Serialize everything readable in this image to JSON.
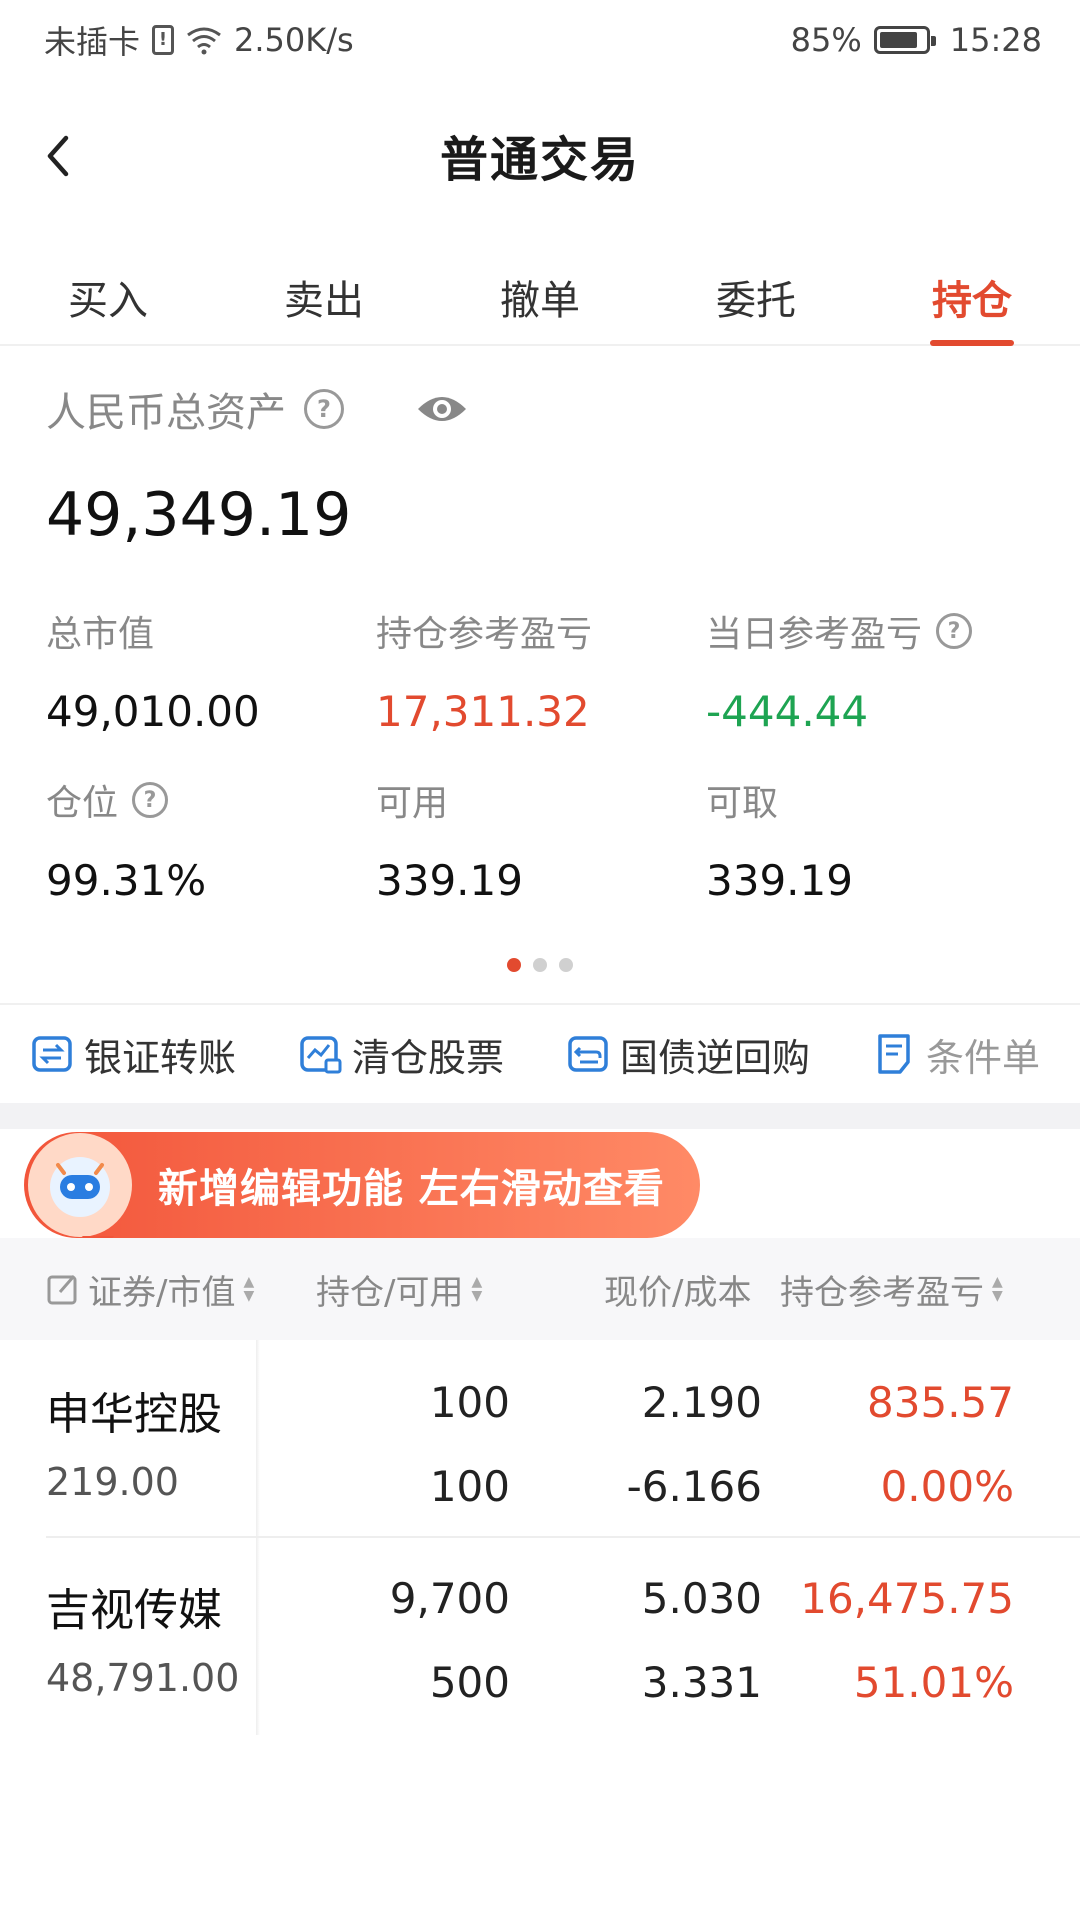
{
  "status_bar": {
    "carrier": "未插卡",
    "speed": "2.50K/s",
    "battery": "85%",
    "battery_level": 0.85,
    "time": "15:28"
  },
  "header": {
    "title": "普通交易"
  },
  "tabs": [
    {
      "label": "买入",
      "active": false
    },
    {
      "label": "卖出",
      "active": false
    },
    {
      "label": "撤单",
      "active": false
    },
    {
      "label": "委托",
      "active": false
    },
    {
      "label": "持仓",
      "active": true
    }
  ],
  "asset": {
    "total_label": "人民币总资产",
    "total_value": "49,349.19",
    "stats": [
      {
        "label": "总市值",
        "value": "49,010.00",
        "color": "default",
        "help": false
      },
      {
        "label": "持仓参考盈亏",
        "value": "17,311.32",
        "color": "red",
        "help": false
      },
      {
        "label": "当日参考盈亏",
        "value": "-444.44",
        "color": "green",
        "help": true
      },
      {
        "label": "仓位",
        "value": "99.31%",
        "color": "default",
        "help": true
      },
      {
        "label": "可用",
        "value": "339.19",
        "color": "default",
        "help": false
      },
      {
        "label": "可取",
        "value": "339.19",
        "color": "default",
        "help": false
      }
    ],
    "page_dots": {
      "count": 3,
      "active": 0
    }
  },
  "quick_actions": [
    {
      "label": "银证转账",
      "icon": "transfer-icon"
    },
    {
      "label": "清仓股票",
      "icon": "chart-clear-icon"
    },
    {
      "label": "国债逆回购",
      "icon": "repo-icon"
    },
    {
      "label": "条件单",
      "icon": "condition-order-icon"
    }
  ],
  "banner": {
    "text": "新增编辑功能 左右滑动查看"
  },
  "table": {
    "headers": {
      "security": "证券/市值",
      "position": "持仓/可用",
      "price": "现价/成本",
      "pnl": "持仓参考盈亏"
    },
    "rows": [
      {
        "name": "申华控股",
        "market_value": "219.00",
        "position": "100",
        "available": "100",
        "price": "2.190",
        "cost": "-6.166",
        "pnl": "835.57",
        "pnl_pct": "0.00%"
      },
      {
        "name": "吉视传媒",
        "market_value": "48,791.00",
        "position": "9,700",
        "available": "500",
        "price": "5.030",
        "cost": "3.331",
        "pnl": "16,475.75",
        "pnl_pct": "51.01%"
      }
    ]
  },
  "colors": {
    "accent": "#e24a2f",
    "gain": "#e24a2f",
    "loss": "#1ea452"
  }
}
